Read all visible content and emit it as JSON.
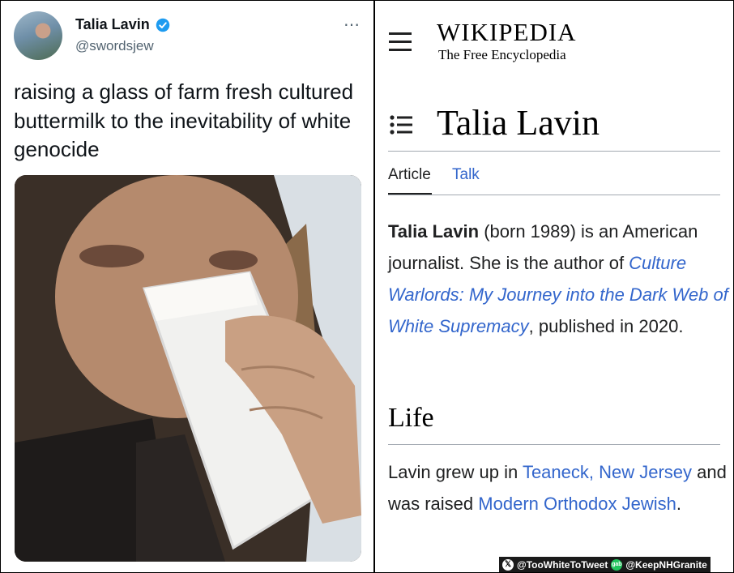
{
  "tweet": {
    "display_name": "Talia Lavin",
    "handle": "@swordsjew",
    "more_icon": "⋯",
    "text": "raising a glass of farm fresh cultured buttermilk to the inevitability of white genocide",
    "verified_color": "#1d9bf0"
  },
  "wiki": {
    "wordmark": "WIKIPEDIA",
    "tagline": "The Free Encyclopedia",
    "page_title": "Talia Lavin",
    "tabs": {
      "article": "Article",
      "talk": "Talk"
    },
    "lead": {
      "name_bold": "Talia Lavin",
      "part1": " (born 1989) is an American journalist. She is the author of ",
      "book_link": "Culture Warlords: My Journey into the Dark Web of White Supremacy",
      "part2": ", published in 2020."
    },
    "section_life": "Life",
    "life": {
      "part1": "Lavin grew up in ",
      "link1": "Teaneck, New Jersey",
      "part2": " and was raised ",
      "link2": "Modern Orthodox Jewish",
      "part3": "."
    },
    "link_color": "#3366cc"
  },
  "watermark": {
    "x_handle": "@TooWhiteToTweet",
    "gab_label": "gab",
    "gab_handle": "@KeepNHGranite"
  }
}
